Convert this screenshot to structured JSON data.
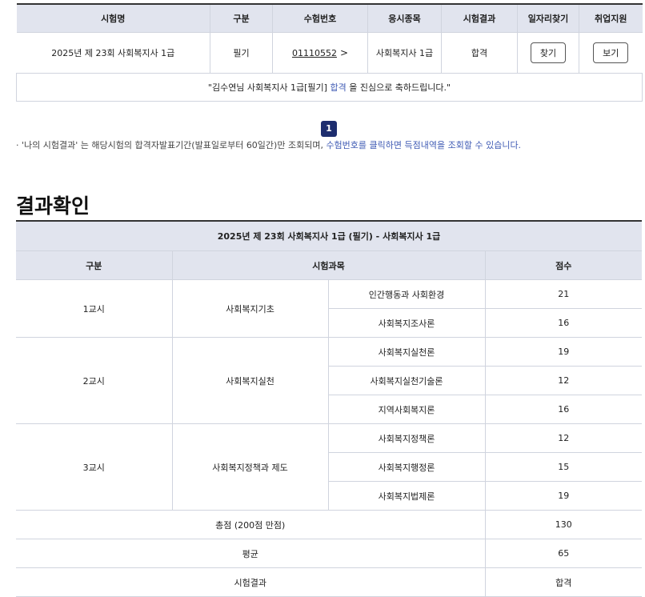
{
  "summary": {
    "headers": [
      "시험명",
      "구분",
      "수험번호",
      "응시종목",
      "시험결과",
      "일자리찾기",
      "취업지원"
    ],
    "exam_name": "2025년 제 23회 사회복지사 1급",
    "type": "필기",
    "exam_number": "01110552",
    "category": "사회복지사 1급",
    "result": "합격",
    "find_job_label": "찾기",
    "support_label": "보기",
    "message_before": "\"김수연님 사회복지사 1급[필기] ",
    "message_highlight": "합격",
    "message_after": " 을 진심으로 축하드립니다.\""
  },
  "pagination": {
    "current": "1"
  },
  "note": {
    "text": "· '나의 시험결과' 는 해당시험의 합격자발표기간(발표일로부터 60일간)만 조회되며, ",
    "link_text": "수험번호를 클릭하면 득점내역을 조회할 수 있습니다."
  },
  "section_title": "결과확인",
  "result": {
    "caption": "2025년 제 23회 사회복지사 1급 (필기) - 사회복지사 1급",
    "headers": {
      "division": "구분",
      "subject": "시험과목",
      "score": "점수"
    },
    "periods": [
      {
        "label": "1교시",
        "area": "사회복지기초",
        "subjects": [
          {
            "name": "인간행동과 사회환경",
            "score": "21"
          },
          {
            "name": "사회복지조사론",
            "score": "16"
          }
        ]
      },
      {
        "label": "2교시",
        "area": "사회복지실천",
        "subjects": [
          {
            "name": "사회복지실천론",
            "score": "19"
          },
          {
            "name": "사회복지실천기술론",
            "score": "12"
          },
          {
            "name": "지역사회복지론",
            "score": "16"
          }
        ]
      },
      {
        "label": "3교시",
        "area": "사회복지정책과 제도",
        "subjects": [
          {
            "name": "사회복지정책론",
            "score": "12"
          },
          {
            "name": "사회복지행정론",
            "score": "15"
          },
          {
            "name": "사회복지법제론",
            "score": "19"
          }
        ]
      }
    ],
    "total_label": "총점 (200점 만점)",
    "total": "130",
    "average_label": "평균",
    "average": "65",
    "result_label": "시험결과",
    "result_value": "합격"
  }
}
